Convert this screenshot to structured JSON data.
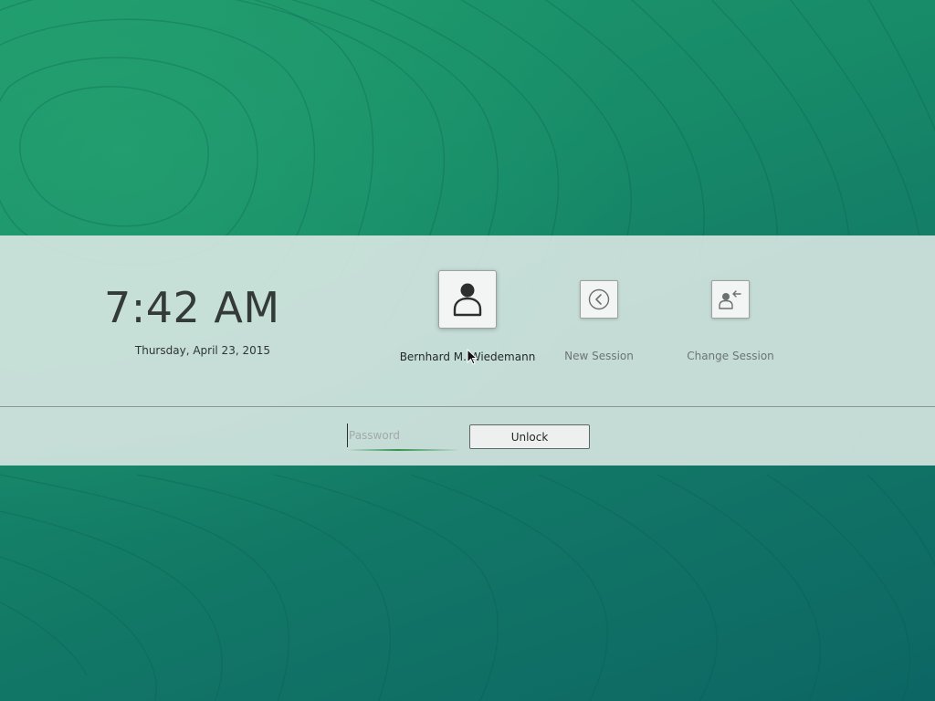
{
  "clock": {
    "time": "7:42 AM",
    "date": "Thursday, April 23, 2015"
  },
  "users": [
    {
      "name": "Bernhard M. Wiedemann",
      "icon": "user-avatar-icon"
    },
    {
      "name": "New Session",
      "icon": "back-arrow-circle-icon"
    },
    {
      "name": "Change Session",
      "icon": "switch-user-icon"
    }
  ],
  "login": {
    "password_placeholder": "Password",
    "password_value": "",
    "unlock_label": "Unlock"
  },
  "colors": {
    "accent": "#268c46",
    "wallpaper": "#178a68",
    "panel": "#dee9e6"
  }
}
